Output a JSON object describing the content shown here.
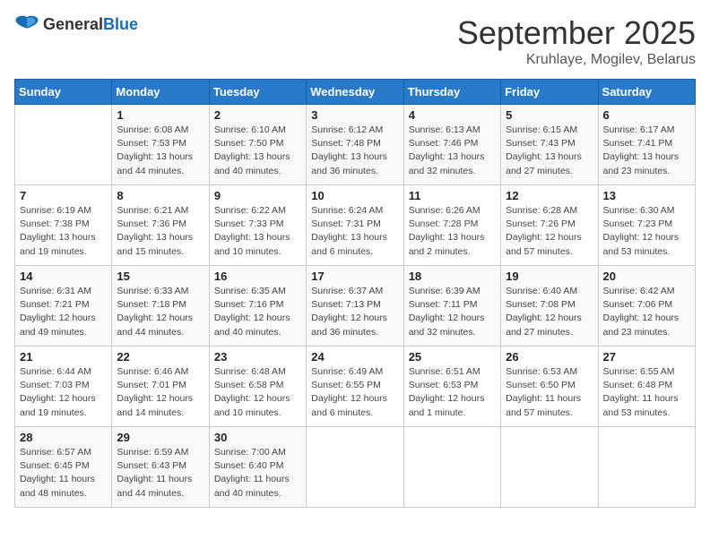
{
  "logo": {
    "general": "General",
    "blue": "Blue"
  },
  "title": "September 2025",
  "location": "Kruhlaye, Mogilev, Belarus",
  "weekdays": [
    "Sunday",
    "Monday",
    "Tuesday",
    "Wednesday",
    "Thursday",
    "Friday",
    "Saturday"
  ],
  "weeks": [
    [
      {
        "day": "",
        "info": ""
      },
      {
        "day": "1",
        "info": "Sunrise: 6:08 AM\nSunset: 7:53 PM\nDaylight: 13 hours\nand 44 minutes."
      },
      {
        "day": "2",
        "info": "Sunrise: 6:10 AM\nSunset: 7:50 PM\nDaylight: 13 hours\nand 40 minutes."
      },
      {
        "day": "3",
        "info": "Sunrise: 6:12 AM\nSunset: 7:48 PM\nDaylight: 13 hours\nand 36 minutes."
      },
      {
        "day": "4",
        "info": "Sunrise: 6:13 AM\nSunset: 7:46 PM\nDaylight: 13 hours\nand 32 minutes."
      },
      {
        "day": "5",
        "info": "Sunrise: 6:15 AM\nSunset: 7:43 PM\nDaylight: 13 hours\nand 27 minutes."
      },
      {
        "day": "6",
        "info": "Sunrise: 6:17 AM\nSunset: 7:41 PM\nDaylight: 13 hours\nand 23 minutes."
      }
    ],
    [
      {
        "day": "7",
        "info": "Sunrise: 6:19 AM\nSunset: 7:38 PM\nDaylight: 13 hours\nand 19 minutes."
      },
      {
        "day": "8",
        "info": "Sunrise: 6:21 AM\nSunset: 7:36 PM\nDaylight: 13 hours\nand 15 minutes."
      },
      {
        "day": "9",
        "info": "Sunrise: 6:22 AM\nSunset: 7:33 PM\nDaylight: 13 hours\nand 10 minutes."
      },
      {
        "day": "10",
        "info": "Sunrise: 6:24 AM\nSunset: 7:31 PM\nDaylight: 13 hours\nand 6 minutes."
      },
      {
        "day": "11",
        "info": "Sunrise: 6:26 AM\nSunset: 7:28 PM\nDaylight: 13 hours\nand 2 minutes."
      },
      {
        "day": "12",
        "info": "Sunrise: 6:28 AM\nSunset: 7:26 PM\nDaylight: 12 hours\nand 57 minutes."
      },
      {
        "day": "13",
        "info": "Sunrise: 6:30 AM\nSunset: 7:23 PM\nDaylight: 12 hours\nand 53 minutes."
      }
    ],
    [
      {
        "day": "14",
        "info": "Sunrise: 6:31 AM\nSunset: 7:21 PM\nDaylight: 12 hours\nand 49 minutes."
      },
      {
        "day": "15",
        "info": "Sunrise: 6:33 AM\nSunset: 7:18 PM\nDaylight: 12 hours\nand 44 minutes."
      },
      {
        "day": "16",
        "info": "Sunrise: 6:35 AM\nSunset: 7:16 PM\nDaylight: 12 hours\nand 40 minutes."
      },
      {
        "day": "17",
        "info": "Sunrise: 6:37 AM\nSunset: 7:13 PM\nDaylight: 12 hours\nand 36 minutes."
      },
      {
        "day": "18",
        "info": "Sunrise: 6:39 AM\nSunset: 7:11 PM\nDaylight: 12 hours\nand 32 minutes."
      },
      {
        "day": "19",
        "info": "Sunrise: 6:40 AM\nSunset: 7:08 PM\nDaylight: 12 hours\nand 27 minutes."
      },
      {
        "day": "20",
        "info": "Sunrise: 6:42 AM\nSunset: 7:06 PM\nDaylight: 12 hours\nand 23 minutes."
      }
    ],
    [
      {
        "day": "21",
        "info": "Sunrise: 6:44 AM\nSunset: 7:03 PM\nDaylight: 12 hours\nand 19 minutes."
      },
      {
        "day": "22",
        "info": "Sunrise: 6:46 AM\nSunset: 7:01 PM\nDaylight: 12 hours\nand 14 minutes."
      },
      {
        "day": "23",
        "info": "Sunrise: 6:48 AM\nSunset: 6:58 PM\nDaylight: 12 hours\nand 10 minutes."
      },
      {
        "day": "24",
        "info": "Sunrise: 6:49 AM\nSunset: 6:55 PM\nDaylight: 12 hours\nand 6 minutes."
      },
      {
        "day": "25",
        "info": "Sunrise: 6:51 AM\nSunset: 6:53 PM\nDaylight: 12 hours\nand 1 minute."
      },
      {
        "day": "26",
        "info": "Sunrise: 6:53 AM\nSunset: 6:50 PM\nDaylight: 11 hours\nand 57 minutes."
      },
      {
        "day": "27",
        "info": "Sunrise: 6:55 AM\nSunset: 6:48 PM\nDaylight: 11 hours\nand 53 minutes."
      }
    ],
    [
      {
        "day": "28",
        "info": "Sunrise: 6:57 AM\nSunset: 6:45 PM\nDaylight: 11 hours\nand 48 minutes."
      },
      {
        "day": "29",
        "info": "Sunrise: 6:59 AM\nSunset: 6:43 PM\nDaylight: 11 hours\nand 44 minutes."
      },
      {
        "day": "30",
        "info": "Sunrise: 7:00 AM\nSunset: 6:40 PM\nDaylight: 11 hours\nand 40 minutes."
      },
      {
        "day": "",
        "info": ""
      },
      {
        "day": "",
        "info": ""
      },
      {
        "day": "",
        "info": ""
      },
      {
        "day": "",
        "info": ""
      }
    ]
  ]
}
